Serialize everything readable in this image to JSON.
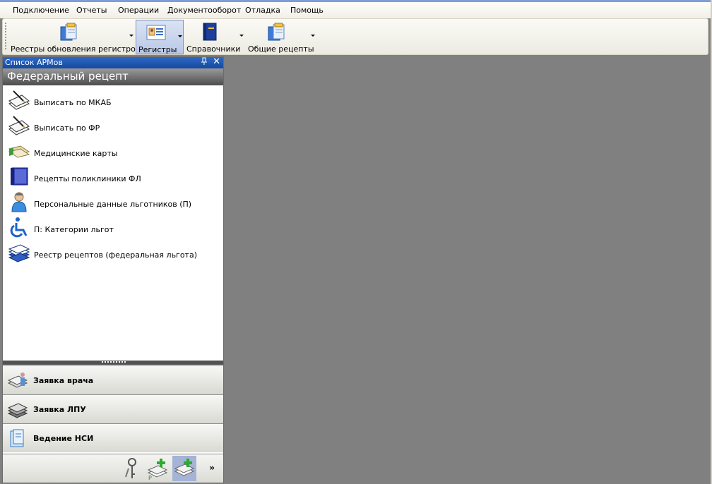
{
  "menu": {
    "items": [
      "Подключение",
      "Отчеты",
      "Операции",
      "Документооборот",
      "Отладка",
      "Помощь"
    ]
  },
  "toolbar": {
    "buttons": [
      {
        "label": "Реестры обновления регистров",
        "icon": "registry-update-icon"
      },
      {
        "label": "Регистры",
        "icon": "registers-card-icon"
      },
      {
        "label": "Справочники",
        "icon": "reference-book-icon"
      },
      {
        "label": "Общие рецепты",
        "icon": "common-recipes-icon"
      }
    ]
  },
  "panel": {
    "title": "Список АРМов",
    "pin_glyph": "ᵖ",
    "close_glyph": "✕",
    "group_title": "Федеральный рецепт",
    "items": [
      {
        "label": "Выписать по МКАБ",
        "icon": "write-prescription-icon"
      },
      {
        "label": "Выписать по ФР",
        "icon": "write-prescription-icon"
      },
      {
        "label": "Медицинские карты",
        "icon": "medical-cards-icon"
      },
      {
        "label": "Рецепты поликлиники ФЛ",
        "icon": "book-icon"
      },
      {
        "label": "Персональные данные льготников (П)",
        "icon": "person-icon"
      },
      {
        "label": "П: Категории льгот",
        "icon": "wheelchair-icon"
      },
      {
        "label": "Реестр рецептов (федеральная льгота)",
        "icon": "registry-stack-icon"
      }
    ],
    "nav_buttons": [
      {
        "label": "Заявка врача",
        "icon": "doctor-request-icon"
      },
      {
        "label": "Заявка ЛПУ",
        "icon": "clinic-request-icon"
      },
      {
        "label": "Ведение НСИ",
        "icon": "nsi-maintenance-icon"
      }
    ],
    "more_glyph": "»"
  }
}
